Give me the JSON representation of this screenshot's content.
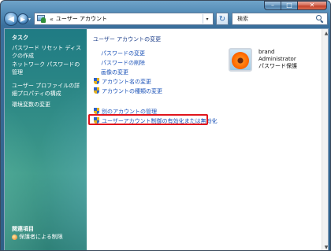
{
  "window": {
    "caption": {
      "minimize": "–",
      "maximize": "□",
      "close": "✕"
    }
  },
  "navbar": {
    "back": "◀",
    "forward": "▶",
    "dropdown": "▾",
    "address": {
      "chevron": "«",
      "text": "ユーザー アカウント",
      "dropdown": "▾"
    },
    "refresh": "↻",
    "search_placeholder": "検索"
  },
  "sidebar": {
    "tasks_heading": "タスク",
    "items": [
      {
        "label": "パスワード リセット ディスクの作成"
      },
      {
        "label": "ネットワーク パスワードの管理"
      },
      {
        "label": "ユーザー プロファイルの詳細プロパティの構成"
      },
      {
        "label": "環境変数の変更"
      }
    ],
    "related_heading": "関連項目",
    "related_items": [
      {
        "label": "保護者による制限"
      }
    ]
  },
  "main": {
    "title": "ユーザー アカウントの変更",
    "tasks": [
      {
        "label": "パスワードの変更"
      },
      {
        "label": "パスワードの削除"
      },
      {
        "label": "画像の変更"
      },
      {
        "label": "アカウント名の変更"
      },
      {
        "label": "アカウントの種類の変更"
      }
    ],
    "other_tasks": [
      {
        "label": "別のアカウントの管理"
      },
      {
        "label": "ユーザーアカウント制御の有効化または無効化"
      }
    ],
    "user": {
      "name": "brand",
      "role": "Administrator",
      "status": "パスワード保護"
    }
  },
  "scrollbar": {
    "up": "▲",
    "down": "▼"
  },
  "colors": {
    "highlight": "#e0151c",
    "link": "#1c53b8",
    "sidebar": "#2f8a86"
  }
}
